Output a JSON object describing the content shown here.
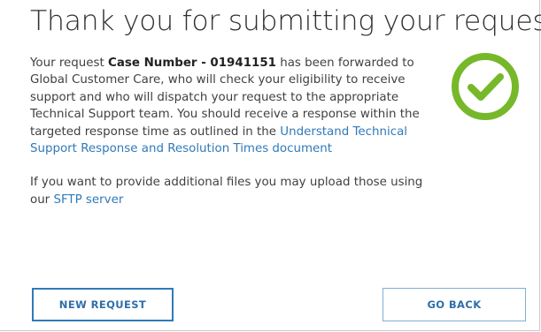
{
  "confirmation": {
    "title": "Thank you for submitting your request.",
    "message": {
      "intro": "Your request ",
      "case_label": "Case Number - 01941151",
      "body": " has been forwarded to Global Customer Care, who will check your eligibility to receive support and who will dispatch your request to the appropriate Technical Support team. You should receive a response within the targeted response time as outlined in the ",
      "link_text": "Understand Technical Support Response and Resolution Times document",
      "files_text": "If you want to provide additional files you may upload those using our ",
      "sftp_link": "SFTP server"
    },
    "check_icon": "check-circle-icon",
    "colors": {
      "check": "#76b82a",
      "link": "#2f7ab9"
    }
  },
  "buttons": {
    "new_request": "NEW REQUEST",
    "go_back": "GO BACK"
  }
}
